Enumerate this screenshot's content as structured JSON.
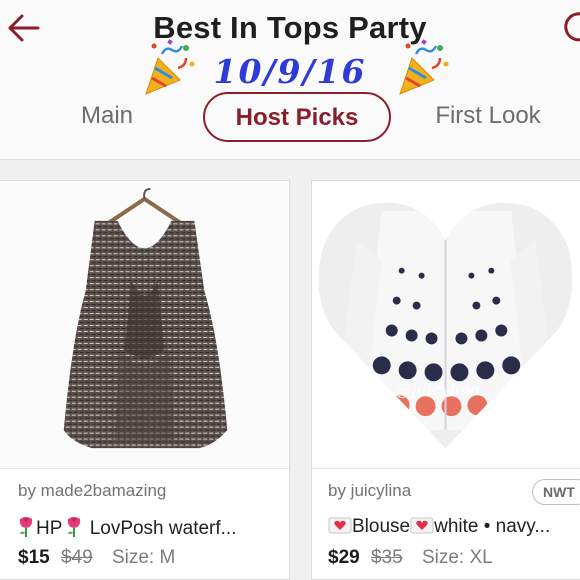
{
  "header": {
    "title": "Best In Tops Party",
    "date": "10/9/16",
    "back_icon": "arrow-left-icon",
    "refresh_icon": "refresh-icon",
    "accent_color": "#8a1f2b",
    "date_color": "#2f3bd6"
  },
  "tabs": [
    {
      "label": "Main",
      "active": false
    },
    {
      "label": "Host Picks",
      "active": true
    },
    {
      "label": "First Look",
      "active": false
    }
  ],
  "listings": [
    {
      "seller": "by made2bamazing",
      "title": "HP LovPosh waterf...",
      "title_parts": [
        "HP",
        "LovPosh waterf..."
      ],
      "title_icons": [
        "tulip-icon",
        "tulip-icon"
      ],
      "price": "$15",
      "original_price": "$49",
      "size": "Size: M",
      "badge": ""
    },
    {
      "seller": "by juicylina",
      "title": "Blouse white • navy...",
      "title_parts": [
        "Blouse",
        "white • navy..."
      ],
      "title_icons": [
        "heart-letter-icon",
        "heart-letter-icon"
      ],
      "price": "$29",
      "original_price": "$35",
      "size": "Size: XL",
      "badge": "NWT",
      "watermark": "@juicylina"
    }
  ]
}
